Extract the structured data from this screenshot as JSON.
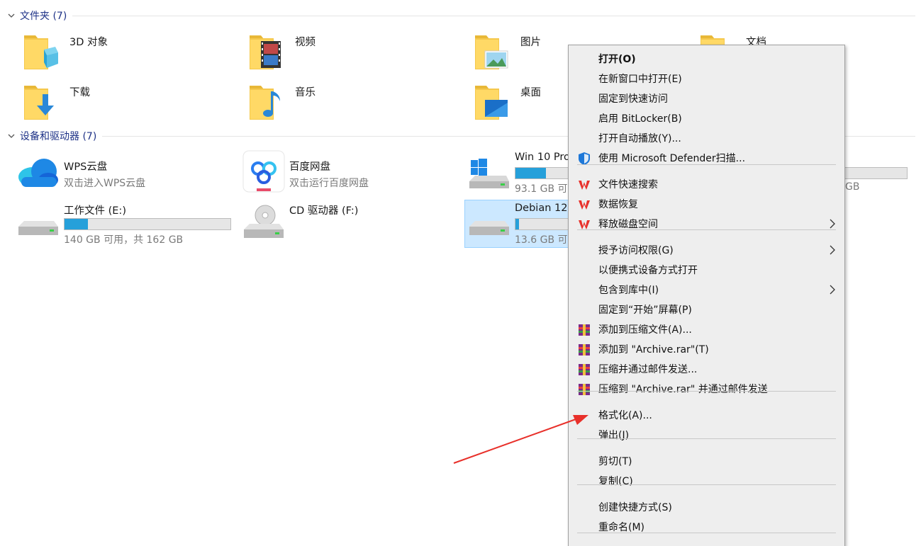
{
  "folders_section": {
    "title": "文件夹 (7)"
  },
  "folders": [
    {
      "name": "3D 对象",
      "icon": "3d-objects-folder-icon"
    },
    {
      "name": "视频",
      "icon": "videos-folder-icon"
    },
    {
      "name": "图片",
      "icon": "pictures-folder-icon"
    },
    {
      "name": "文档",
      "icon": "documents-folder-icon"
    },
    {
      "name": "下载",
      "icon": "downloads-folder-icon"
    },
    {
      "name": "音乐",
      "icon": "music-folder-icon"
    },
    {
      "name": "桌面",
      "icon": "desktop-folder-icon"
    }
  ],
  "devices_section": {
    "title": "设备和驱动器 (7)"
  },
  "devices": [
    {
      "name": "WPS云盘",
      "sub": "双击进入WPS云盘",
      "icon": "wps-cloud-icon"
    },
    {
      "name": "百度网盘",
      "sub": "双击运行百度网盘",
      "icon": "baidu-netdisk-icon"
    },
    {
      "name": "Win 10 Pro",
      "free": "93.1 GB 可",
      "used_fraction": 0.55,
      "icon": "windows-drive-icon"
    },
    {
      "name": "",
      "free": "GB",
      "used_fraction": 0.0,
      "icon": "drive-icon"
    },
    {
      "name": "工作文件 (E:)",
      "free": "140 GB 可用，共 162 GB",
      "used_fraction": 0.14,
      "icon": "drive-icon"
    },
    {
      "name": "CD 驱动器 (F:)",
      "icon": "cd-drive-icon"
    },
    {
      "name": "Debian 12.",
      "free": "13.6 GB 可",
      "used_fraction": 0.07,
      "icon": "drive-icon"
    }
  ],
  "context_menu": {
    "items": [
      {
        "label": "打开(O)",
        "bold": true
      },
      {
        "label": "在新窗口中打开(E)"
      },
      {
        "label": "固定到快速访问"
      },
      {
        "label": "启用 BitLocker(B)"
      },
      {
        "label": "打开自动播放(Y)..."
      },
      {
        "label": "使用 Microsoft Defender扫描...",
        "icon": "defender-shield-icon"
      },
      {
        "label": "文件快速搜索",
        "icon": "wps-icon"
      },
      {
        "label": "数据恢复",
        "icon": "wps-icon"
      },
      {
        "label": "释放磁盘空间",
        "icon": "wps-icon",
        "submenu": true
      },
      {
        "label": "授予访问权限(G)",
        "submenu": true
      },
      {
        "label": "以便携式设备方式打开"
      },
      {
        "label": "包含到库中(I)",
        "submenu": true
      },
      {
        "label": "固定到“开始”屏幕(P)"
      },
      {
        "label": "添加到压缩文件(A)...",
        "icon": "winrar-icon"
      },
      {
        "label": "添加到 \"Archive.rar\"(T)",
        "icon": "winrar-icon"
      },
      {
        "label": "压缩并通过邮件发送...",
        "icon": "winrar-icon"
      },
      {
        "label": "压缩到 \"Archive.rar\" 并通过邮件发送",
        "icon": "winrar-icon"
      },
      {
        "label": "格式化(A)..."
      },
      {
        "label": "弹出(J)"
      },
      {
        "label": "剪切(T)"
      },
      {
        "label": "复制(C)"
      },
      {
        "label": "创建快捷方式(S)"
      },
      {
        "label": "重命名(M)"
      }
    ]
  },
  "colors": {
    "accent": "#26a0da",
    "section_title": "#1e3287",
    "selection": "#cce8ff",
    "annotation_arrow": "#e8302a",
    "menu_bg": "#eeeeee"
  }
}
